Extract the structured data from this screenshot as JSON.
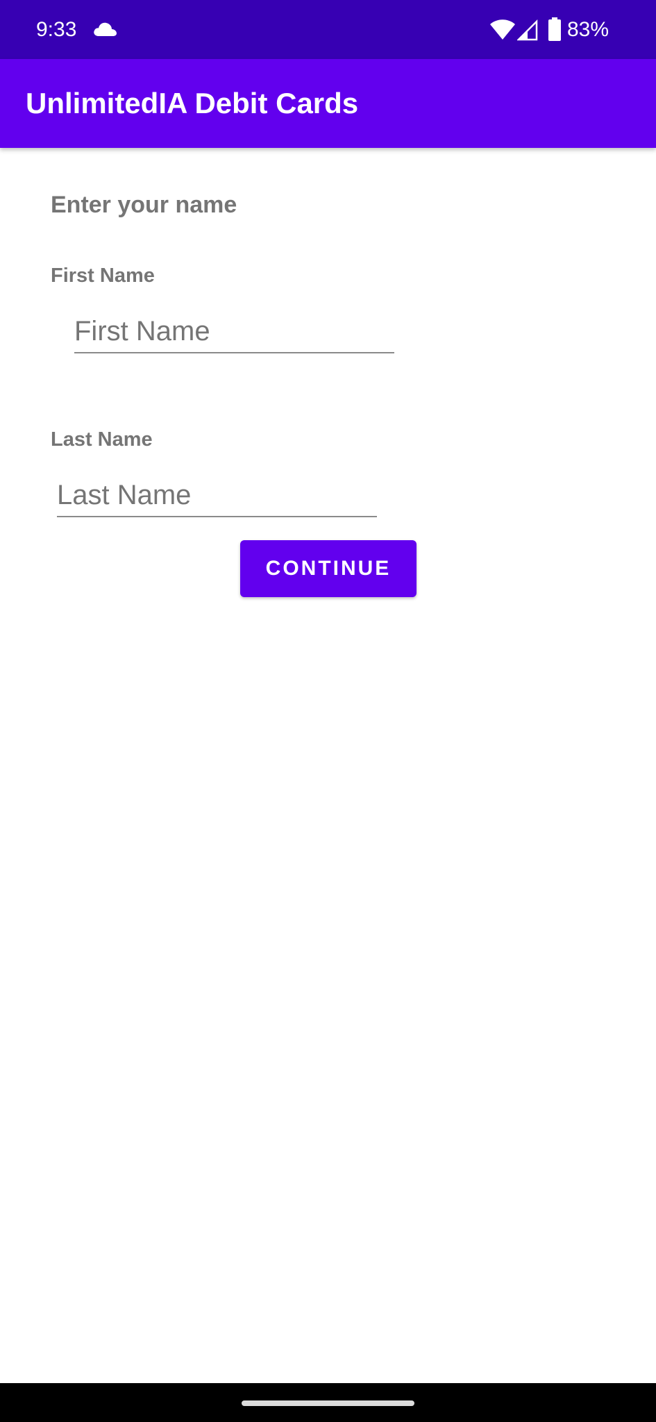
{
  "status_bar": {
    "time": "9:33",
    "battery": "83%",
    "icons": [
      "cloud-icon",
      "wifi-icon",
      "cell-signal-icon",
      "battery-icon"
    ]
  },
  "app_bar": {
    "title": "UnlimitedIA Debit Cards",
    "color": "#6200ee"
  },
  "form": {
    "heading": "Enter your name",
    "first_name": {
      "label": "First Name",
      "value": "",
      "placeholder": "First Name"
    },
    "last_name": {
      "label": "Last Name",
      "value": "",
      "placeholder": "Last Name"
    },
    "continue_label": "CONTINUE"
  },
  "colors": {
    "status_bar": "#3700b3",
    "accent": "#6200ee",
    "label_text": "#757575"
  }
}
